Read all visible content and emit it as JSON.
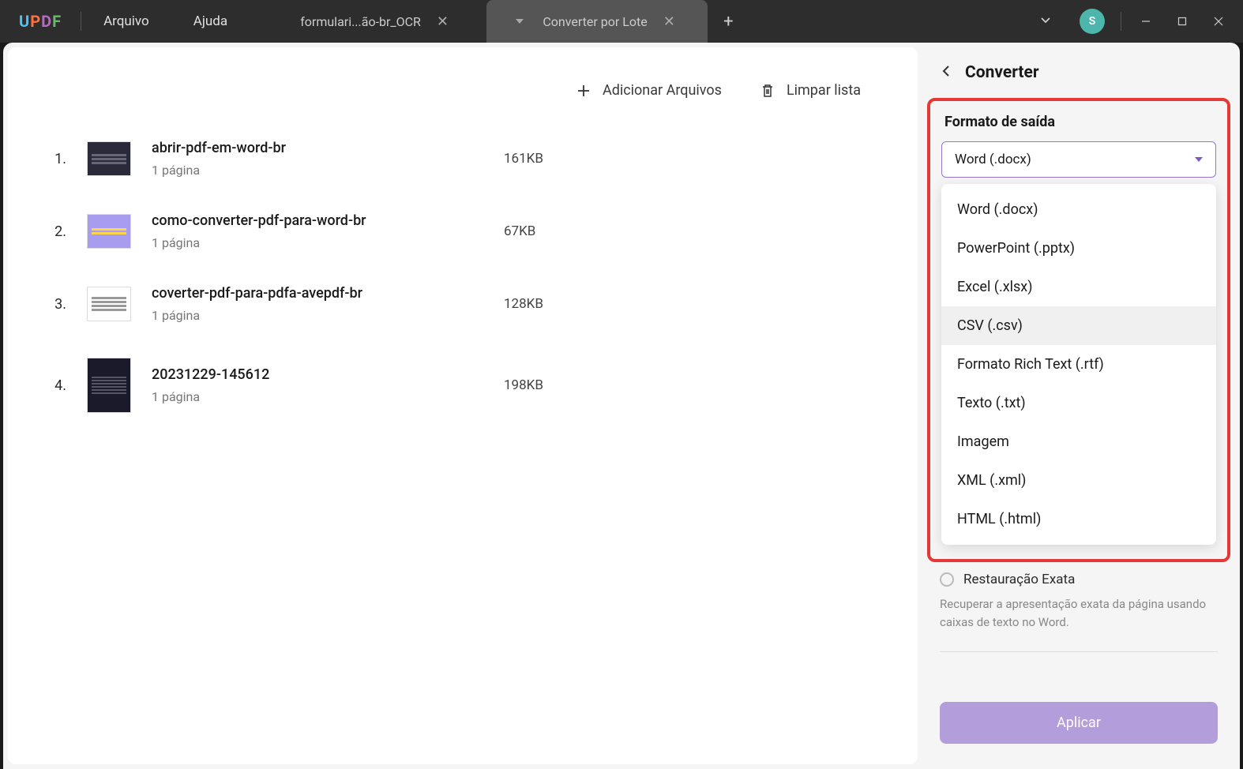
{
  "titlebar": {
    "logo": {
      "u": "U",
      "p": "P",
      "d": "D",
      "f": "F"
    },
    "menu": {
      "file": "Arquivo",
      "help": "Ajuda"
    },
    "tabs": [
      {
        "label": "formulari...ão-br_OCR",
        "active": false
      },
      {
        "label": "Converter por Lote",
        "active": true
      }
    ],
    "avatar": "S"
  },
  "toolbar": {
    "add_files": "Adicionar Arquivos",
    "clear_list": "Limpar lista"
  },
  "files": [
    {
      "num": "1.",
      "name": "abrir-pdf-em-word-br",
      "pages": "1 página",
      "size": "161KB",
      "thumb": "dark"
    },
    {
      "num": "2.",
      "name": "como-converter-pdf-para-word-br",
      "pages": "1 página",
      "size": "67KB",
      "thumb": "purple"
    },
    {
      "num": "3.",
      "name": "coverter-pdf-para-pdfa-avepdf-br",
      "pages": "1 página",
      "size": "128KB",
      "thumb": "white"
    },
    {
      "num": "4.",
      "name": "20231229-145612",
      "pages": "1 página",
      "size": "198KB",
      "thumb": "code"
    }
  ],
  "side": {
    "title": "Converter",
    "format_label": "Formato de saída",
    "format_selected": "Word (.docx)",
    "format_options": [
      "Word (.docx)",
      "PowerPoint (.pptx)",
      "Excel (.xlsx)",
      "CSV (.csv)",
      "Formato Rich Text (.rtf)",
      "Texto (.txt)",
      "Imagem",
      "XML (.xml)",
      "HTML (.html)"
    ],
    "radio_label": "Restauração Exata",
    "help_text": "Recuperar a apresentação exata da página usando caixas de texto no Word.",
    "apply": "Aplicar"
  }
}
